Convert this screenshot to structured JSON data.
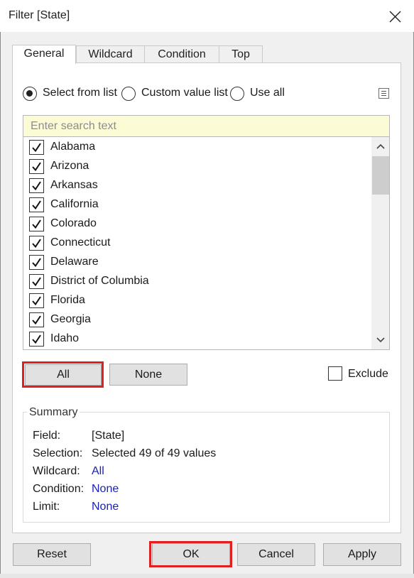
{
  "window": {
    "title": "Filter [State]"
  },
  "tabs": [
    {
      "label": "General",
      "active": true
    },
    {
      "label": "Wildcard",
      "active": false
    },
    {
      "label": "Condition",
      "active": false
    },
    {
      "label": "Top",
      "active": false
    }
  ],
  "mode": {
    "options": [
      "Select from list",
      "Custom value list",
      "Use all"
    ],
    "selected": "Select from list"
  },
  "search": {
    "placeholder": "Enter search text",
    "value": ""
  },
  "list": {
    "items": [
      {
        "label": "Alabama",
        "checked": true
      },
      {
        "label": "Arizona",
        "checked": true
      },
      {
        "label": "Arkansas",
        "checked": true
      },
      {
        "label": "California",
        "checked": true
      },
      {
        "label": "Colorado",
        "checked": true
      },
      {
        "label": "Connecticut",
        "checked": true
      },
      {
        "label": "Delaware",
        "checked": true
      },
      {
        "label": "District of Columbia",
        "checked": true
      },
      {
        "label": "Florida",
        "checked": true
      },
      {
        "label": "Georgia",
        "checked": true
      },
      {
        "label": "Idaho",
        "checked": true
      }
    ]
  },
  "buttons": {
    "all": "All",
    "none": "None",
    "reset": "Reset",
    "ok": "OK",
    "cancel": "Cancel",
    "apply": "Apply"
  },
  "exclude": {
    "label": "Exclude",
    "checked": false
  },
  "summary": {
    "title": "Summary",
    "rows": [
      {
        "key": "Field:",
        "value": "[State]",
        "link": false
      },
      {
        "key": "Selection:",
        "value": "Selected 49 of 49 values",
        "link": false
      },
      {
        "key": "Wildcard:",
        "value": "All",
        "link": true
      },
      {
        "key": "Condition:",
        "value": "None",
        "link": true
      },
      {
        "key": "Limit:",
        "value": "None",
        "link": true
      }
    ]
  },
  "colors": {
    "highlight": "#e02020",
    "link": "#1a20b8",
    "search_bg": "#fbfbd6"
  },
  "icons": {
    "close": "close-icon",
    "menu": "list-menu-icon",
    "check": "checkmark-icon"
  }
}
